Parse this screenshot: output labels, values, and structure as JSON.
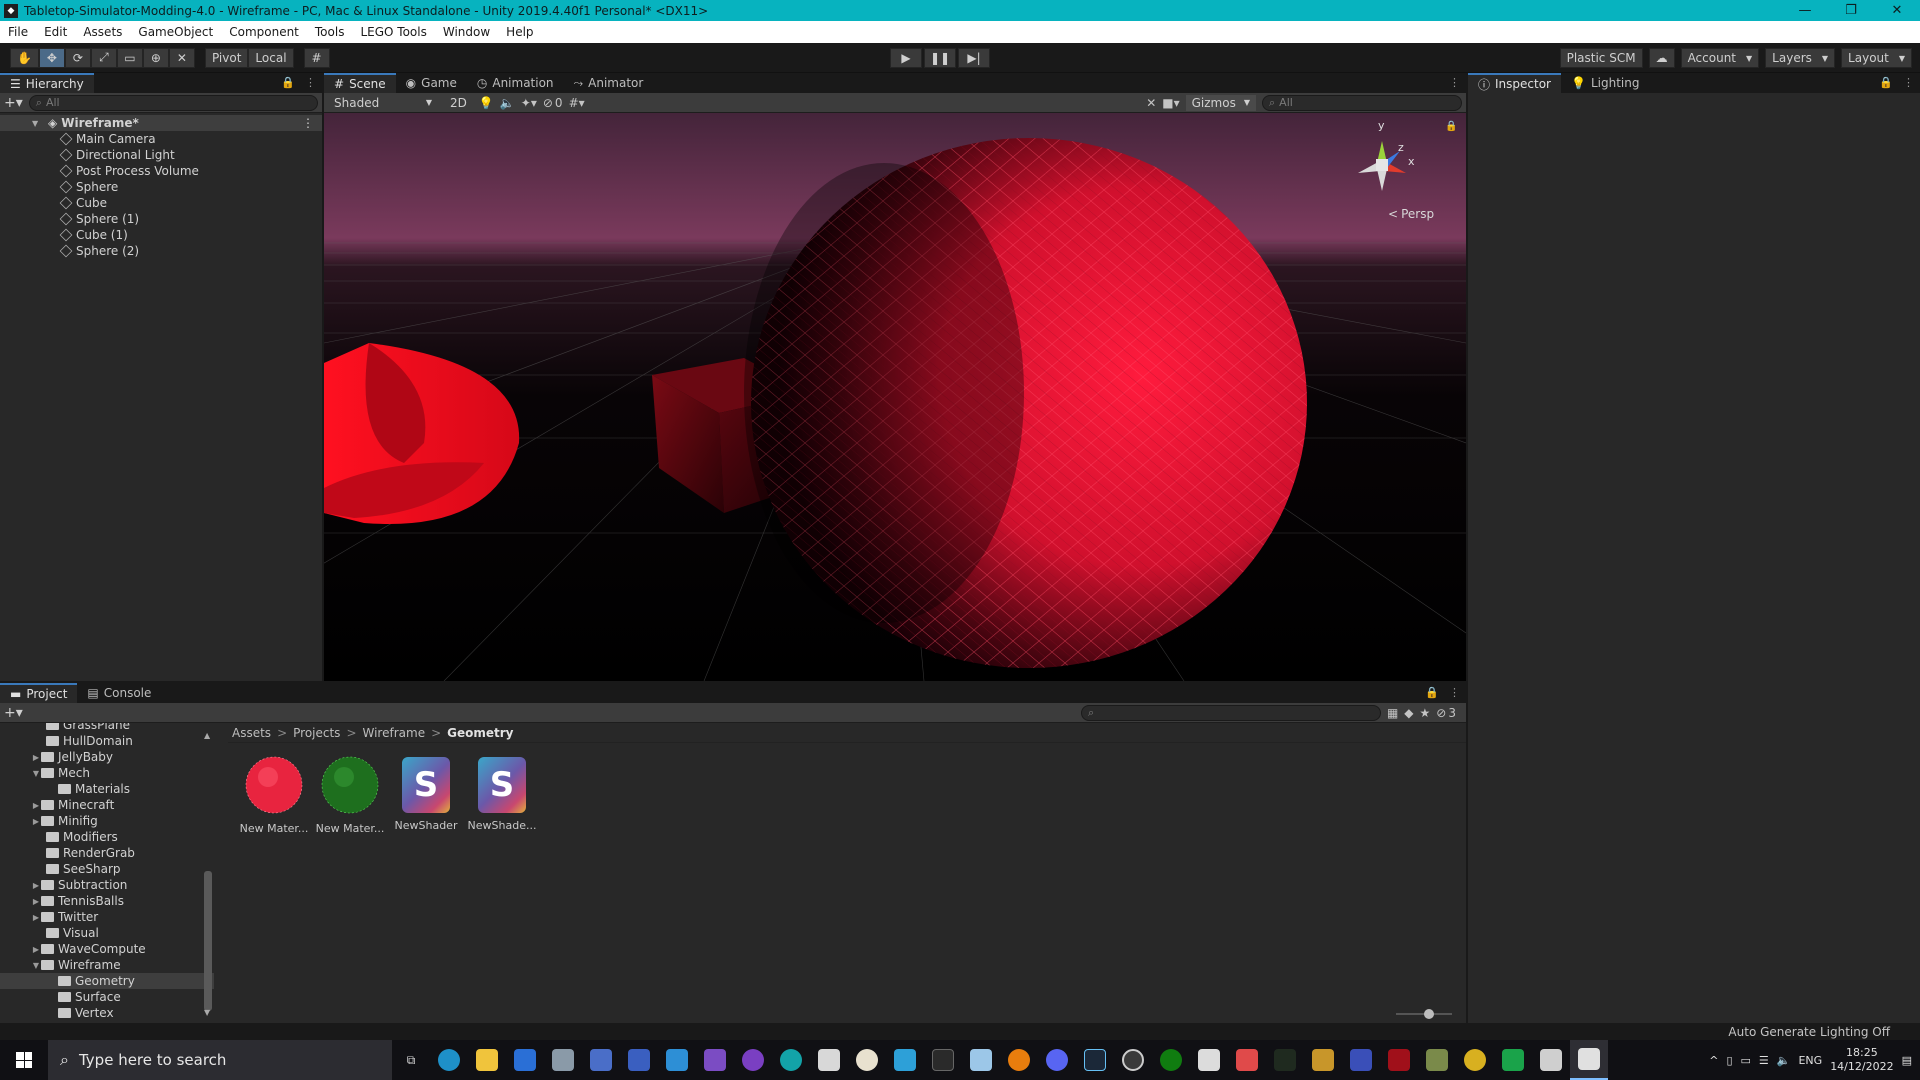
{
  "window": {
    "title": "Tabletop-Simulator-Modding-4.0 - Wireframe - PC, Mac & Linux Standalone - Unity 2019.4.40f1 Personal* <DX11>"
  },
  "menu": [
    "File",
    "Edit",
    "Assets",
    "GameObject",
    "Component",
    "Tools",
    "LEGO Tools",
    "Window",
    "Help"
  ],
  "toolbar": {
    "pivot": "Pivot",
    "local": "Local",
    "plastic": "Plastic SCM",
    "account": "Account",
    "layers": "Layers",
    "layout": "Layout"
  },
  "hierarchy": {
    "tab": "Hierarchy",
    "search_placeholder": "All",
    "scene_name": "Wireframe*",
    "objects": [
      "Main Camera",
      "Directional Light",
      "Post Process Volume",
      "Sphere",
      "Cube",
      "Sphere (1)",
      "Cube (1)",
      "Sphere (2)"
    ]
  },
  "scene": {
    "tabs": [
      "Scene",
      "Game",
      "Animation",
      "Animator"
    ],
    "shading": "Shaded",
    "mode_2d": "2D",
    "hidden_count": "0",
    "gizmos": "Gizmos",
    "search_placeholder": "All",
    "persp": "Persp",
    "axis_y": "y",
    "axis_x": "x",
    "axis_z": "z"
  },
  "inspector": {
    "tabs": [
      "Inspector",
      "Lighting"
    ]
  },
  "project": {
    "tabs": [
      "Project",
      "Console"
    ],
    "hidden_count": "3",
    "breadcrumb": [
      "Assets",
      "Projects",
      "Wireframe",
      "Geometry"
    ],
    "folders": [
      {
        "name": "GrassPlane",
        "arrow": ""
      },
      {
        "name": "HullDomain",
        "arrow": ""
      },
      {
        "name": "JellyBaby",
        "arrow": "▶"
      },
      {
        "name": "Mech",
        "arrow": "▼"
      },
      {
        "name": "Materials",
        "arrow": ""
      },
      {
        "name": "Minecraft",
        "arrow": "▶"
      },
      {
        "name": "Minifig",
        "arrow": "▶"
      },
      {
        "name": "Modifiers",
        "arrow": ""
      },
      {
        "name": "RenderGrab",
        "arrow": ""
      },
      {
        "name": "SeeSharp",
        "arrow": ""
      },
      {
        "name": "Subtraction",
        "arrow": "▶"
      },
      {
        "name": "TennisBalls",
        "arrow": "▶"
      },
      {
        "name": "Twitter",
        "arrow": "▶"
      },
      {
        "name": "Visual",
        "arrow": ""
      },
      {
        "name": "WaveCompute",
        "arrow": "▶"
      },
      {
        "name": "Wireframe",
        "arrow": "▼"
      },
      {
        "name": "Geometry",
        "arrow": ""
      },
      {
        "name": "Surface",
        "arrow": ""
      },
      {
        "name": "Vertex",
        "arrow": ""
      }
    ],
    "assets": [
      {
        "label": "New Mater...",
        "kind": "material",
        "color": "#e8243f"
      },
      {
        "label": "New Mater...",
        "kind": "material",
        "color": "#2a8f2a"
      },
      {
        "label": "NewShader",
        "kind": "shader",
        "glyph": "S"
      },
      {
        "label": "NewShade...",
        "kind": "shader",
        "glyph": "S"
      }
    ]
  },
  "status": {
    "text": "Auto Generate Lighting Off"
  },
  "taskbar": {
    "search_placeholder": "Type here to search",
    "language": "ENG",
    "time": "18:25",
    "date": "14/12/2022"
  },
  "colors": {
    "accent": "#07b3bf",
    "selection": "#3a79bb",
    "scene_red": "#ff1030"
  }
}
